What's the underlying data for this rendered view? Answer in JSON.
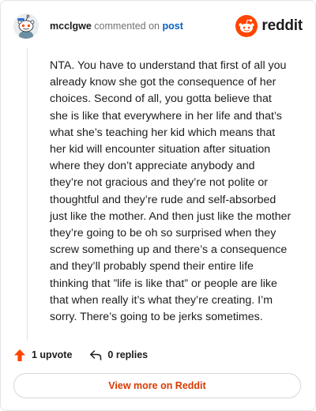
{
  "header": {
    "username": "mcclgwe",
    "action_text": "commented on",
    "post_link": "post",
    "brand_name": "reddit"
  },
  "comment": {
    "text": "NTA. You have to understand that first of all you already know she got the consequence of her choices. Second of all, you gotta believe that she is like that everywhere in her life and that’s what she’s teaching her kid which means that her kid will encounter situation after situation where they don’t appreciate anybody and they’re not gracious and they’re not polite or thoughtful and they’re rude and self-absorbed just like the mother. And then just like the mother they’re going to be oh so surprised when they screw something up and there’s a consequence and they’ll probably spend their entire life thinking that ”life is like that” or people are like that when really it’s what they’re creating. I’m sorry. There’s going to be jerks sometimes."
  },
  "actions": {
    "upvote_label": "1 upvote",
    "upvote_icon": "upvote-arrow-icon",
    "replies_label": "0 replies",
    "replies_icon": "reply-arrow-icon"
  },
  "footer": {
    "view_more_label": "View more on Reddit"
  },
  "colors": {
    "brand_orange": "#ff4500",
    "link_blue": "#0a5fc4",
    "view_more_text": "#d93a00",
    "upvote": "#ff4500"
  }
}
